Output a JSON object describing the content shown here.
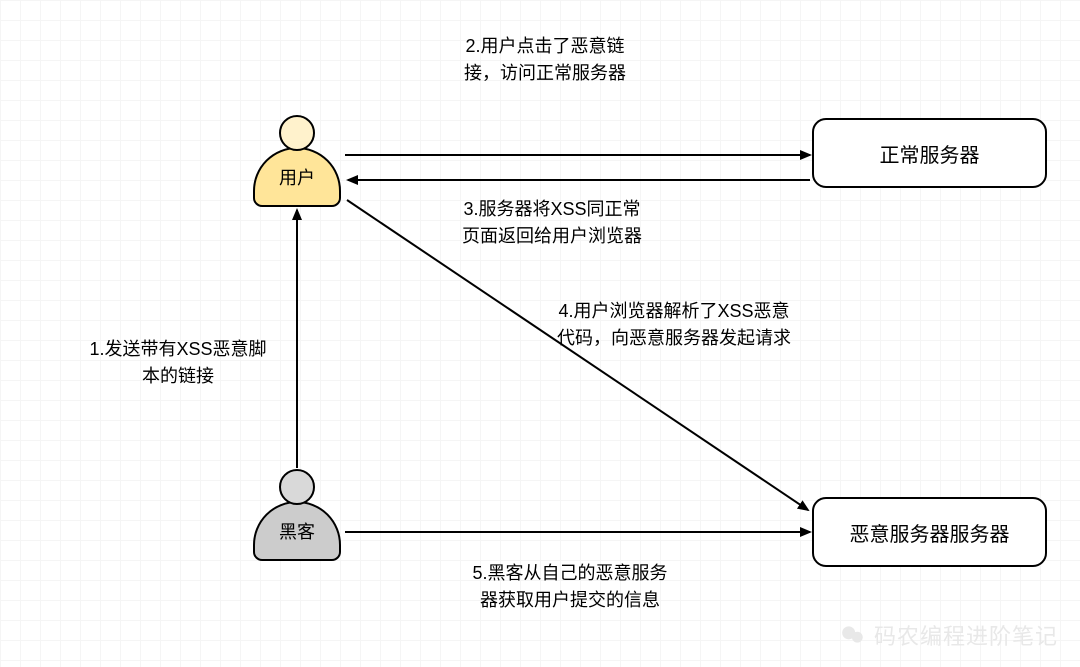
{
  "nodes": {
    "user": {
      "label": "用户"
    },
    "hacker": {
      "label": "黑客"
    },
    "normal_server": {
      "label": "正常服务器"
    },
    "malicious_server": {
      "label": "恶意服务器服务器"
    }
  },
  "steps": {
    "s1": "1.发送带有XSS恶意脚\n本的链接",
    "s2": "2.用户点击了恶意链\n接，访问正常服务器",
    "s3": "3.服务器将XSS同正常\n页面返回给用户浏览器",
    "s4": "4.用户浏览器解析了XSS恶意\n代码，向恶意服务器发起请求",
    "s5": "5.黑客从自己的恶意服务\n器获取用户提交的信息"
  },
  "watermark": {
    "text": "码农编程进阶笔记"
  }
}
